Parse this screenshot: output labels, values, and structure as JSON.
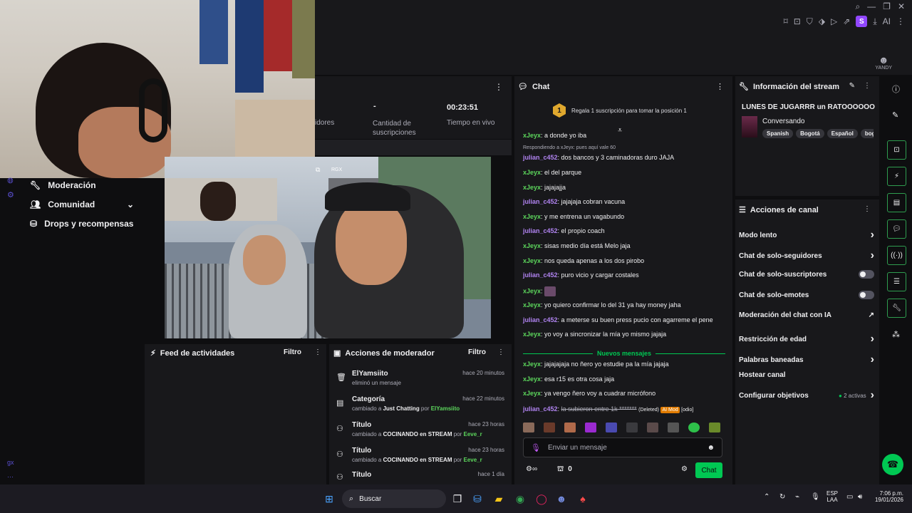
{
  "window": {
    "controls": [
      "⌕",
      "—",
      "❐",
      "✕"
    ]
  },
  "toolbar": {
    "icons": [
      "bookmark-icon",
      "crop-icon",
      "shield-icon",
      "tag-icon",
      "play-icon",
      "share-icon"
    ],
    "avatar": "S",
    "ai": "AI"
  },
  "brand": {
    "logo_text": "YANDY"
  },
  "stats": {
    "seguidores": "idores",
    "suscripciones_value": "-",
    "suscripciones_label": "Cantidad de suscripciones",
    "tiempo_value": "00:23:51",
    "tiempo_label": "Tiempo en vivo"
  },
  "sidebar": {
    "items": [
      {
        "label": "Moderación",
        "icon": "wrench-icon"
      },
      {
        "label": "Comunidad",
        "icon": "people-icon"
      },
      {
        "label": "Drops y recompensas",
        "icon": "gift-icon"
      }
    ],
    "bottom_text": "gx"
  },
  "video": {
    "badge": "RGX"
  },
  "feed": {
    "title": "Feed de actividades",
    "filter": "Filtro"
  },
  "modact": {
    "title": "Acciones de moderador",
    "filter": "Filtro",
    "rows": [
      {
        "title": "ElYamsiito",
        "sub": "eliminó un mensaje",
        "time": "hace 20 minutos"
      },
      {
        "title": "Categoría",
        "sub_pre": "cambiado a ",
        "sub_bold": "Just Chatting",
        "sub_mid": " por ",
        "sub_user": "ElYamsiito",
        "time": "hace 22 minutos"
      },
      {
        "title": "Título",
        "sub_pre": "cambiado a ",
        "sub_bold": "COCINANDO en STREAM",
        "sub_mid": " por ",
        "sub_user": "Eeve_r",
        "time": "hace 23 horas"
      },
      {
        "title": "Título",
        "sub_pre": "cambiado a ",
        "sub_bold": "COCINANDO en STREAM",
        "sub_mid": " por ",
        "sub_user": "Eeve_r",
        "time": "hace 23 horas"
      },
      {
        "title": "Título",
        "time": "hace 1 día"
      }
    ]
  },
  "chat": {
    "title": "Chat",
    "pinned_number": "1",
    "pinned_text": "Regala 1 suscripción para tomar la posición 1",
    "reply_note": "Respondiendo a xJeyx: pues aquí vale 60",
    "messages": [
      {
        "user": "xJeyx",
        "color": "green",
        "text": "a donde yo iba"
      },
      {
        "user": "julian_c452",
        "color": "purple",
        "text": "dos bancos y 3 caminadoras duro JAJA"
      },
      {
        "user": "xJeyx",
        "color": "green",
        "text": "el del parque"
      },
      {
        "user": "xJeyx",
        "color": "green",
        "text": "jajajajja"
      },
      {
        "user": "julian_c452",
        "color": "purple",
        "text": "jajajaja cobran vacuna"
      },
      {
        "user": "xJeyx",
        "color": "green",
        "text": "y me entrena un vagabundo"
      },
      {
        "user": "julian_c452",
        "color": "purple",
        "text": "el propio coach"
      },
      {
        "user": "xJeyx",
        "color": "green",
        "text": "sisas medio día está Melo jaja"
      },
      {
        "user": "xJeyx",
        "color": "green",
        "text": "nos queda apenas a los dos pirobo"
      },
      {
        "user": "julian_c452",
        "color": "purple",
        "text": "puro vicio y cargar costales"
      },
      {
        "user": "xJeyx",
        "color": "green",
        "text": ""
      },
      {
        "user": "xJeyx",
        "color": "green",
        "text": "yo quiero confirmar lo del 31 ya hay money jaha"
      },
      {
        "user": "julian_c452",
        "color": "purple",
        "text": "a meterse su buen press pucio con agarreme el pene"
      },
      {
        "user": "xJeyx",
        "color": "green",
        "text": "yo voy a sincronizar la mía yo mismo jajaja"
      }
    ],
    "new_divider": "Nuevos mensajes",
    "new_messages": [
      {
        "user": "xJeyx",
        "color": "green",
        "text": "jajajajaja no ñero yo estudie pa la mía jajaja"
      },
      {
        "user": "xJeyx",
        "color": "green",
        "text": "esa r15 es otra cosa jaja"
      },
      {
        "user": "xJeyx",
        "color": "green",
        "text": "ya vengo ñero voy a cuadrar micrófono"
      }
    ],
    "deleted": {
      "user": "julian_c452",
      "text": "la subieron entre 1k *******",
      "deleted_label": "(Deleted)",
      "automod": "AI Mod",
      "tag": "[odio]"
    },
    "input_placeholder": "Enviar un mensaje",
    "points": "0",
    "send": "Chat"
  },
  "info": {
    "title": "Información del stream",
    "stream_title": "LUNES DE JUGARRR un RATOOOOOO",
    "category": "Conversando",
    "tags": [
      "Spanish",
      "Bogotá",
      "Español",
      "bog"
    ]
  },
  "canal": {
    "title": "Acciones de canal",
    "rows": [
      {
        "label": "Modo lento",
        "control": "chevron"
      },
      {
        "label": "Chat de solo-seguidores",
        "control": "chevron"
      },
      {
        "label": "Chat de solo-suscriptores",
        "control": "toggle"
      },
      {
        "label": "Chat de solo-emotes",
        "control": "toggle"
      },
      {
        "label": "Moderación del chat con IA",
        "control": "ext"
      },
      {
        "label": "Restricción de edad",
        "control": "chevron"
      },
      {
        "label": "Palabras baneadas",
        "control": "chevron"
      },
      {
        "label": "Hostear canal",
        "control": "none"
      },
      {
        "label": "Configurar objetivos",
        "control": "chevron",
        "extra": "2 activas"
      }
    ]
  },
  "taskbar": {
    "search": "Buscar",
    "lang": "ESP",
    "lang2": "LAA",
    "time": "7:06 p.m.",
    "date": "19/01/2026"
  },
  "colors": {
    "green": "#5cd65c",
    "purple": "#b083f0",
    "accent": "#00c853",
    "brand": "#9147ff"
  }
}
